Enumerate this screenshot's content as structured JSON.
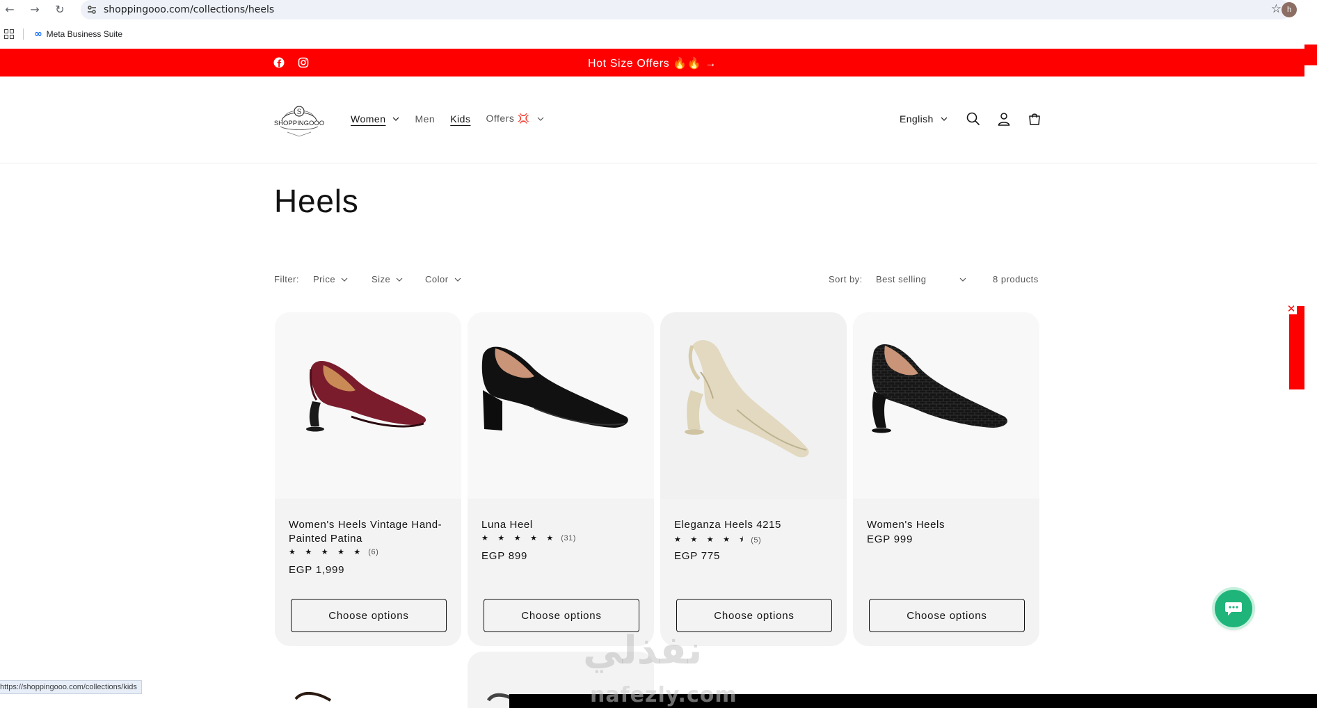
{
  "browser": {
    "url": "shoppingooo.com/collections/heels",
    "profile_initial": "h",
    "bookmark": "Meta Business Suite",
    "status_url": "https://shoppingooo.com/collections/kids"
  },
  "announcement": {
    "text": "Hot Size Offers 🔥🔥 →",
    "bg_color": "#ff0000",
    "social": [
      "facebook-icon",
      "instagram-icon"
    ]
  },
  "header": {
    "logo_text": "SHOPPINGOOO",
    "nav": [
      {
        "label": "Women",
        "dropdown": true,
        "active": true
      },
      {
        "label": "Men",
        "dropdown": false,
        "active": false
      },
      {
        "label": "Kids",
        "dropdown": false,
        "active": true
      },
      {
        "label": "Offers 💢",
        "dropdown": true,
        "active": false
      }
    ],
    "language": "English"
  },
  "page": {
    "title": "Heels"
  },
  "filters": {
    "label": "Filter:",
    "options": [
      "Price",
      "Size",
      "Color"
    ],
    "sort_label": "Sort by:",
    "sort_value": "Best selling",
    "count": "8 products"
  },
  "products": [
    {
      "title": "Women's Heels Vintage Hand-Painted Patina",
      "stars": "★ ★ ★ ★ ★",
      "rating_count": "(6)",
      "price": "EGP 1,999",
      "button": "Choose options",
      "rating": 5
    },
    {
      "title": "Luna Heel",
      "stars": "★ ★ ★ ★ ★",
      "rating_count": "(31)",
      "price": "EGP 899",
      "button": "Choose options",
      "rating": 5
    },
    {
      "title": "Eleganza Heels 4215",
      "stars": "★ ★ ★ ★ ⯨",
      "rating_count": "(5)",
      "price": "EGP 775",
      "button": "Choose options",
      "rating": 4.5
    },
    {
      "title": "Women's Heels",
      "stars": "",
      "rating_count": "",
      "price": "EGP 999",
      "button": "Choose options",
      "rating": null
    }
  ],
  "watermark": {
    "arabic": "نفذلي",
    "latin": "nafezly.com"
  },
  "colors": {
    "accent_red": "#ff0000",
    "card_bg": "#f3f3f3",
    "chat_green": "#1fb57a"
  }
}
